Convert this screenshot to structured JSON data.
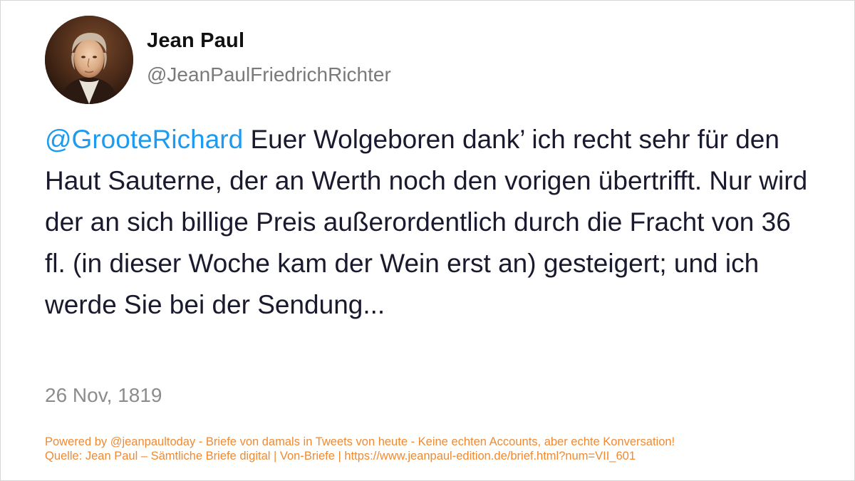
{
  "author": {
    "display_name": "Jean Paul",
    "handle": "@JeanPaulFriedrichRichter",
    "avatar_icon": "portrait-avatar"
  },
  "tweet": {
    "mention": "@GrooteRichard",
    "body": " Euer Wolgeboren dank’ ich recht sehr für den Haut Sauterne, der an Werth noch den vorigen übertrifft. Nur wird der an sich billige Preis außerordentlich durch die Fracht von 36 fl. (in dieser Woche kam der Wein erst an) gesteigert; und ich werde Sie bei der Sendung...",
    "date": "26 Nov, 1819"
  },
  "footer": {
    "powered_by": "Powered by @jeanpaultoday - Briefe von damals in Tweets von heute - Keine echten Accounts, aber echte Konversation!",
    "source": "Quelle: Jean Paul – Sämtliche Briefe digital | Von-Briefe | https://www.jeanpaul-edition.de/brief.html?num=VII_601"
  },
  "colors": {
    "mention": "#1d9bf0",
    "body_text": "#1a1a2e",
    "muted_text": "#7a7a7a",
    "footer_text": "#f08a32"
  }
}
